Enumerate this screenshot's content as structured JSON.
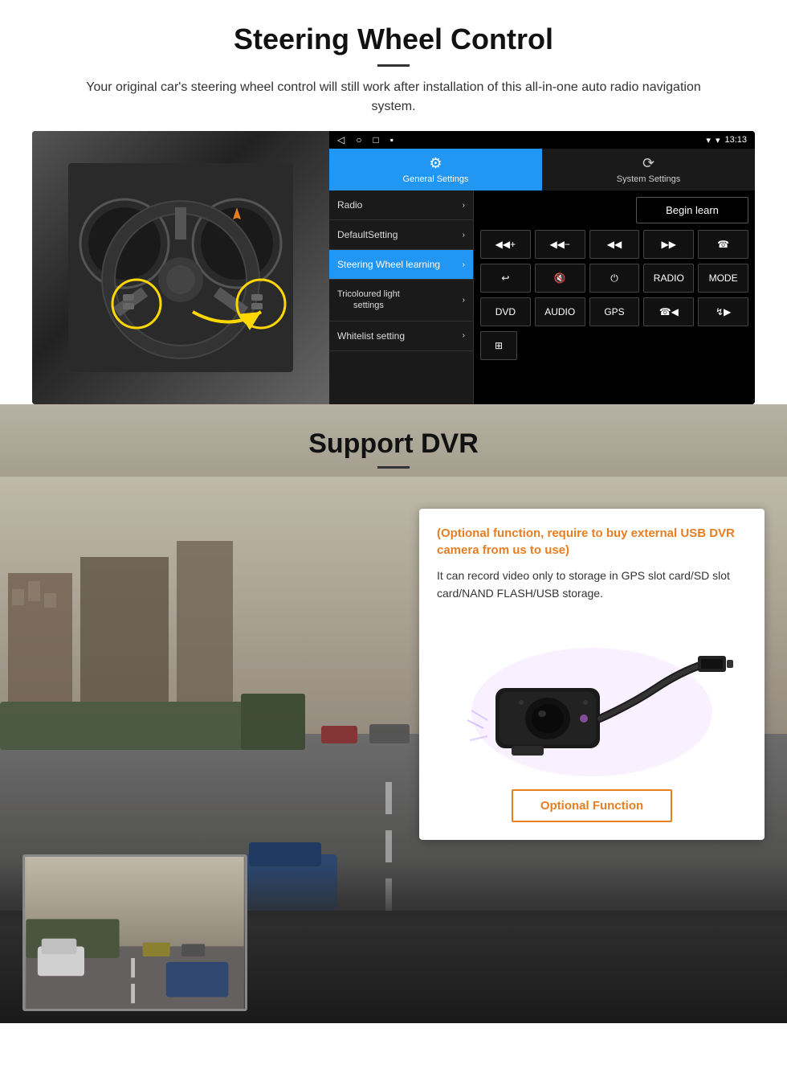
{
  "steering": {
    "title": "Steering Wheel Control",
    "description": "Your original car's steering wheel control will still work after installation of this all-in-one auto radio navigation system.",
    "statusbar": {
      "nav_back": "◁",
      "nav_home": "○",
      "nav_square": "□",
      "nav_dot": "▪",
      "time": "13:13",
      "signal": "▼",
      "wifi": "▾"
    },
    "tabs": [
      {
        "icon": "⚙",
        "label": "General Settings",
        "active": true
      },
      {
        "icon": "⟳",
        "label": "System Settings",
        "active": false
      }
    ],
    "menu": [
      {
        "label": "Radio",
        "active": false
      },
      {
        "label": "DefaultSetting",
        "active": false
      },
      {
        "label": "Steering Wheel learning",
        "active": true
      },
      {
        "label": "Tricoloured light settings",
        "active": false
      },
      {
        "label": "Whitelist setting",
        "active": false
      }
    ],
    "begin_learn": "Begin learn",
    "ctrl_row1": [
      "◀◀+",
      "◀◀−",
      "◀◀",
      "▶▶",
      "☎"
    ],
    "ctrl_row2": [
      "↩",
      "🔇×",
      "⏻",
      "RADIO",
      "MODE"
    ],
    "ctrl_row3": [
      "DVD",
      "AUDIO",
      "GPS",
      "☎◀◀",
      "↯▶▶"
    ],
    "ctrl_row4": [
      "⊞"
    ]
  },
  "dvr": {
    "title": "Support DVR",
    "optional_heading": "(Optional function, require to buy external USB DVR camera from us to use)",
    "description": "It can record video only to storage in GPS slot card/SD slot card/NAND FLASH/USB storage.",
    "optional_button": "Optional Function"
  }
}
